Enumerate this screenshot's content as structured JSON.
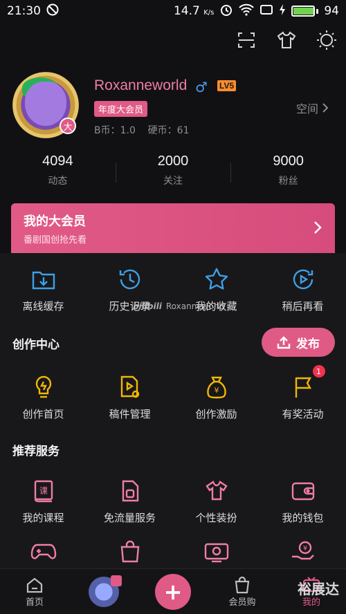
{
  "status_bar": {
    "time": "21:30",
    "speed": "14.7",
    "speed_unit": "K/s",
    "battery": "94",
    "battery_level": 0.94
  },
  "profile": {
    "username": "Roxanneworld",
    "level": "LV5",
    "avatar_badge": "大",
    "vip_tag": "年度大会员",
    "coins": "B币：1.0    硬币：61",
    "space_label": "空间"
  },
  "stats": [
    {
      "num": "4094",
      "label": "动态"
    },
    {
      "num": "2000",
      "label": "关注"
    },
    {
      "num": "9000",
      "label": "粉丝"
    }
  ],
  "vip_card": {
    "title": "我的大会员",
    "subtitle": "番剧国创抢先看"
  },
  "quick_items": [
    {
      "label": "离线缓存",
      "icon": "download-folder-icon"
    },
    {
      "label": "历史记录",
      "icon": "history-clock-icon"
    },
    {
      "label": "我的收藏",
      "icon": "star-icon"
    },
    {
      "label": "稍后再看",
      "icon": "watch-later-icon"
    }
  ],
  "watermark": {
    "brand": "bilibili",
    "user": "Roxanneworld"
  },
  "creator": {
    "title": "创作中心",
    "publish_label": "发布",
    "items": [
      {
        "label": "创作首页",
        "icon": "lightbulb-icon"
      },
      {
        "label": "稿件管理",
        "icon": "manuscript-icon"
      },
      {
        "label": "创作激励",
        "icon": "money-bag-icon"
      },
      {
        "label": "有奖活动",
        "icon": "flag-icon",
        "badge": "1"
      }
    ]
  },
  "services": {
    "title": "推荐服务",
    "items": [
      {
        "label": "我的课程",
        "icon": "course-book-icon"
      },
      {
        "label": "免流量服务",
        "icon": "sim-card-icon"
      },
      {
        "label": "个性装扮",
        "icon": "tshirt-icon"
      },
      {
        "label": "我的钱包",
        "icon": "wallet-icon"
      }
    ],
    "row2_icons": [
      "gamepad-icon",
      "shopping-bag-icon",
      "tv-icon",
      "hand-coin-icon"
    ]
  },
  "bottom_nav": [
    {
      "label": "首页",
      "icon": "home-icon"
    },
    {
      "label": "",
      "icon": "dynamic-avatar"
    },
    {
      "label": "+",
      "icon": "plus-icon"
    },
    {
      "label": "会员购",
      "icon": "shopping-bag-icon"
    },
    {
      "label": "我的",
      "icon": "tv-icon"
    }
  ],
  "corner_watermark": "裕展达",
  "colors": {
    "accent": "#e05a86",
    "background": "#111114",
    "panel": "#18181b",
    "icon_blue": "#3fa0e6",
    "icon_gold": "#f2b705"
  }
}
